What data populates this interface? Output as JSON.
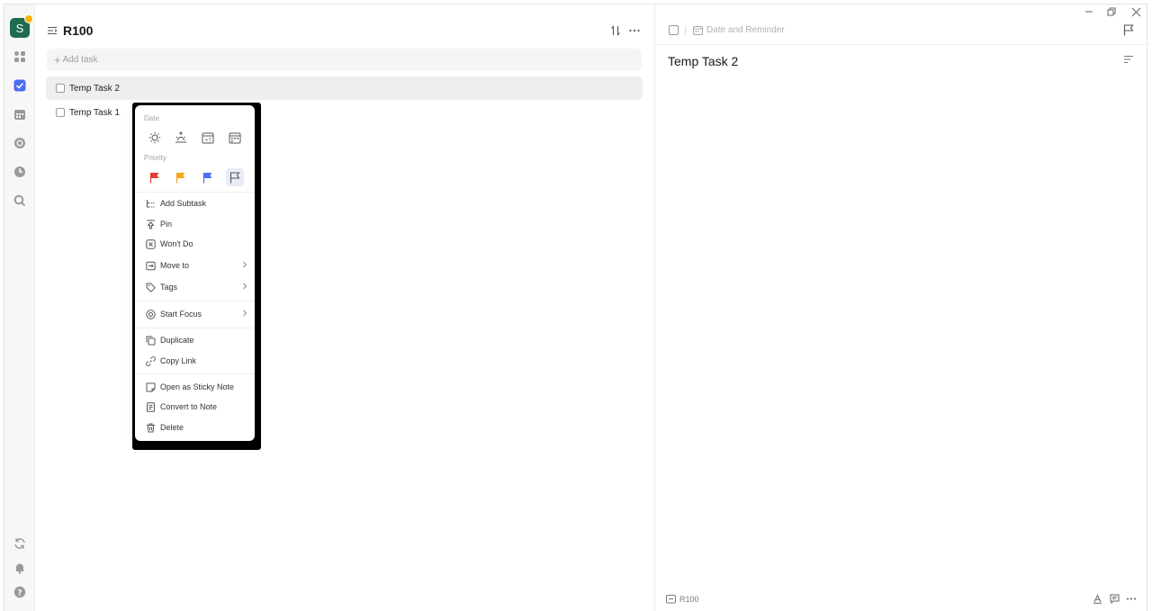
{
  "list": {
    "title": "R100",
    "add_task_placeholder": "Add task",
    "tasks": [
      {
        "label": "Temp Task 2",
        "selected": true
      },
      {
        "label": "Temp Task 1",
        "selected": false
      }
    ]
  },
  "avatar": {
    "letter": "S"
  },
  "context_menu": {
    "date_label": "Date",
    "priority_label": "Priority",
    "priority_colors": [
      "#e53935",
      "#f5a623",
      "#4a6ef5",
      "#8a8a8a"
    ],
    "items": {
      "add_subtask": "Add Subtask",
      "pin": "Pin",
      "wont_do": "Won't Do",
      "move_to": "Move to",
      "tags": "Tags",
      "start_focus": "Start Focus",
      "duplicate": "Duplicate",
      "copy_link": "Copy Link",
      "open_sticky": "Open as Sticky Note",
      "convert_note": "Convert to Note",
      "delete": "Delete"
    }
  },
  "detail": {
    "date_reminder": "Date and Reminder",
    "title": "Temp Task 2",
    "footer_list": "R100"
  },
  "colors": {
    "accent": "#4a6ef5",
    "avatar_bg": "#1f6b4f"
  }
}
